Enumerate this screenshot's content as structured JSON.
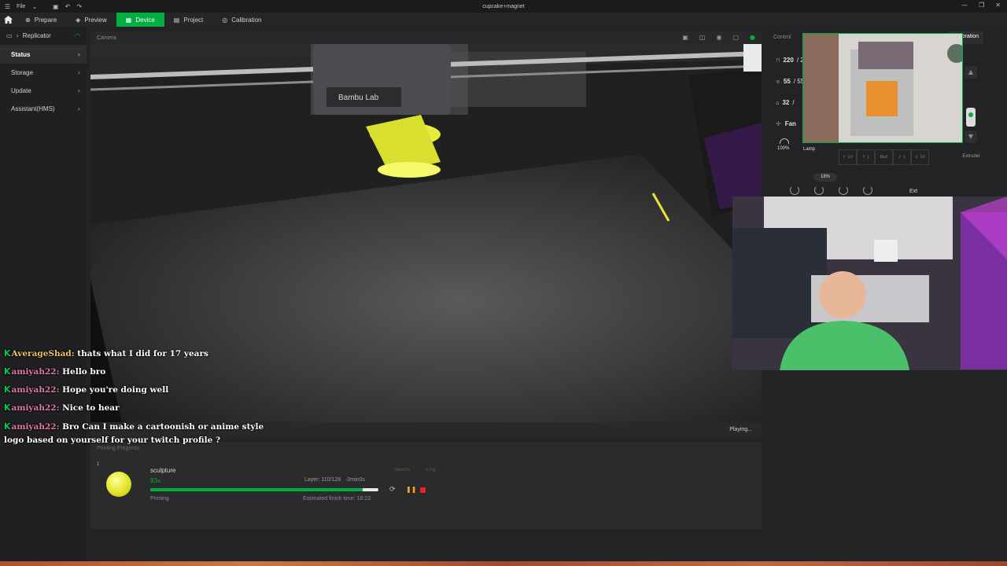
{
  "window": {
    "menu_label": "File",
    "title": "cupcake+magnet"
  },
  "nav": {
    "tabs": [
      {
        "label": "Prepare"
      },
      {
        "label": "Preview"
      },
      {
        "label": "Device"
      },
      {
        "label": "Project"
      },
      {
        "label": "Calibration"
      }
    ]
  },
  "sidebar": {
    "printer_name": "Replicator",
    "items": [
      {
        "label": "Status"
      },
      {
        "label": "Storage"
      },
      {
        "label": "Update"
      },
      {
        "label": "Assistant(HMS)"
      }
    ]
  },
  "camera": {
    "header": "Camera",
    "status": "Playing...",
    "brand": "Bambu Lab"
  },
  "progress": {
    "section_label": "Printing Progress",
    "job_number": "1",
    "job_name": "sculpture",
    "percent": "93",
    "percent_unit": "%",
    "percent_value": 93,
    "layer": "Layer: 110/128",
    "remaining": "-2min0s",
    "extra1": "3item61s",
    "extra2": "4.23g",
    "state": "Printing",
    "finish": "Estimated finish time: 18:23"
  },
  "control": {
    "header": "Control",
    "calibration_label": "Calibration",
    "nozzle_temp": "220",
    "nozzle_target": "/ 2",
    "bed_temp": "55",
    "bed_target": "/ 55",
    "chamber_temp": "32",
    "chamber_target": "/",
    "fan_label": "Fan",
    "speed_label": "100%",
    "lamp_label": "Lamp",
    "bed_buttons": [
      "10",
      "1",
      "Bed",
      "1",
      "10"
    ],
    "extruder_label": "Extruder",
    "speed_percent": "18",
    "speed_unit": "%",
    "ext_label": "Ext"
  },
  "chat": {
    "messages": [
      {
        "user": "AverageShad:",
        "text": "thats what I did for 17 years",
        "color": "#e9c46a"
      },
      {
        "user": "amiyah22:",
        "text": "Hello bro",
        "color": "#e07aa7"
      },
      {
        "user": "amiyah22:",
        "text": "Hope you're doing well",
        "color": "#e07aa7"
      },
      {
        "user": "amiyah22:",
        "text": "Nice to hear",
        "color": "#e07aa7"
      },
      {
        "user": "amiyah22:",
        "text": "Bro Can I make a cartoonish or anime style logo based on yourself for your twitch profile ?",
        "color": "#e07aa7"
      }
    ]
  },
  "colors": {
    "accent": "#00ae42",
    "filament": "#e3e329",
    "pause": "#f0a326",
    "stop": "#e22222"
  }
}
